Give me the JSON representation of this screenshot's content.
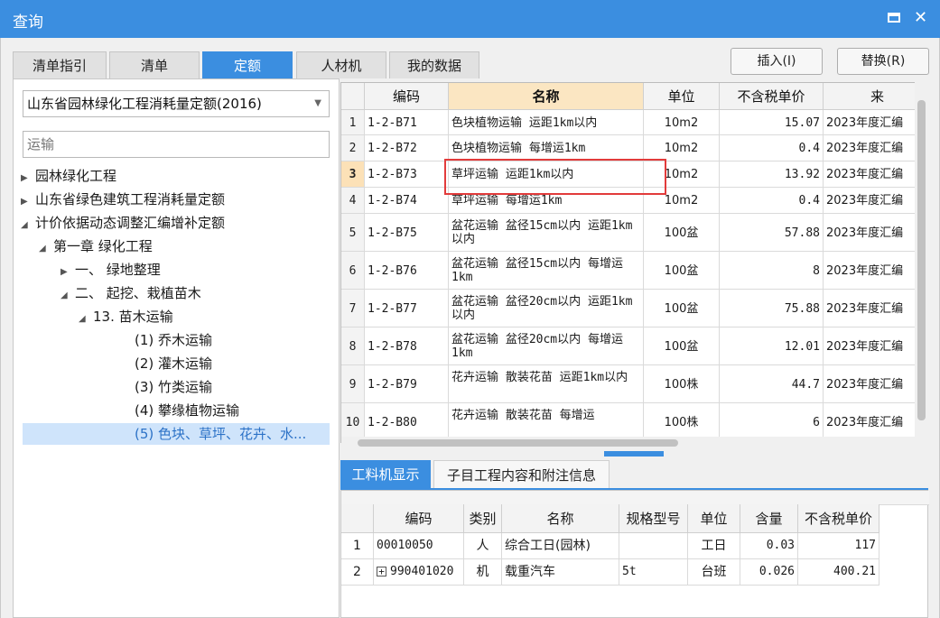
{
  "window": {
    "title": "查询",
    "max_icon": "maximize-icon",
    "close_glyph": "✕"
  },
  "tabs": [
    {
      "label": "清单指引",
      "active": false
    },
    {
      "label": "清单",
      "active": false
    },
    {
      "label": "定额",
      "active": true
    },
    {
      "label": "人材机",
      "active": false
    },
    {
      "label": "我的数据",
      "active": false
    }
  ],
  "actions": {
    "insert_label": "插入(I)",
    "replace_label": "替换(R)"
  },
  "left": {
    "library": "山东省园林绿化工程消耗量定额(2016)",
    "search_placeholder": "运输",
    "tree": [
      {
        "label": "园林绿化工程",
        "arrow": "▶",
        "selected": false
      },
      {
        "label": "山东省绿色建筑工程消耗量定额",
        "arrow": "▶",
        "selected": false
      },
      {
        "label": "计价依据动态调整汇编增补定额",
        "arrow": "◢",
        "selected": false
      },
      {
        "label": "第一章 绿化工程",
        "arrow": "◢",
        "selected": false
      },
      {
        "label": "一、 绿地整理",
        "arrow": "▶",
        "selected": false
      },
      {
        "label": "二、 起挖、栽植苗木",
        "arrow": "◢",
        "selected": false
      },
      {
        "label": "13. 苗木运输",
        "arrow": "◢",
        "selected": false
      },
      {
        "label": "(1) 乔木运输",
        "arrow": "",
        "selected": false
      },
      {
        "label": "(2) 灌木运输",
        "arrow": "",
        "selected": false
      },
      {
        "label": "(3) 竹类运输",
        "arrow": "",
        "selected": false
      },
      {
        "label": "(4) 攀缘植物运输",
        "arrow": "",
        "selected": false
      },
      {
        "label": "(5) 色块、草坪、花卉、水...",
        "arrow": "",
        "selected": true
      }
    ]
  },
  "grid": {
    "headers": [
      "",
      "编码",
      "名称",
      "单位",
      "不含税单价",
      "来"
    ],
    "rows": [
      {
        "n": "1",
        "code": "1-2-B71",
        "name": "色块植物运输 运距1km以内",
        "unit": "10m2",
        "price": "15.07",
        "src": "2023年度汇编"
      },
      {
        "n": "2",
        "code": "1-2-B72",
        "name": "色块植物运输 每增运1km",
        "unit": "10m2",
        "price": "0.4",
        "src": "2023年度汇编"
      },
      {
        "n": "3",
        "code": "1-2-B73",
        "name": "草坪运输 运距1km以内",
        "unit": "10m2",
        "price": "13.92",
        "src": "2023年度汇编"
      },
      {
        "n": "4",
        "code": "1-2-B74",
        "name": "草坪运输 每增运1km",
        "unit": "10m2",
        "price": "0.4",
        "src": "2023年度汇编"
      },
      {
        "n": "5",
        "code": "1-2-B75",
        "name": "盆花运输 盆径15cm以内 运距1km以内",
        "unit": "100盆",
        "price": "57.88",
        "src": "2023年度汇编"
      },
      {
        "n": "6",
        "code": "1-2-B76",
        "name": "盆花运输 盆径15cm以内 每增运1km",
        "unit": "100盆",
        "price": "8",
        "src": "2023年度汇编"
      },
      {
        "n": "7",
        "code": "1-2-B77",
        "name": "盆花运输 盆径20cm以内 运距1km以内",
        "unit": "100盆",
        "price": "75.88",
        "src": "2023年度汇编"
      },
      {
        "n": "8",
        "code": "1-2-B78",
        "name": "盆花运输 盆径20cm以内 每增运1km",
        "unit": "100盆",
        "price": "12.01",
        "src": "2023年度汇编"
      },
      {
        "n": "9",
        "code": "1-2-B79",
        "name": "花卉运输 散装花苗 运距1km以内",
        "unit": "100株",
        "price": "44.7",
        "src": "2023年度汇编"
      },
      {
        "n": "10",
        "code": "1-2-B80",
        "name": "花卉运输 散装花苗 每增运",
        "unit": "100株",
        "price": "6",
        "src": "2023年度汇编"
      }
    ],
    "current_row": "3"
  },
  "bottom_tabs": [
    {
      "label": "工料机显示",
      "active": true
    },
    {
      "label": "子目工程内容和附注信息",
      "active": false
    }
  ],
  "bottom_grid": {
    "headers": [
      "",
      "编码",
      "类别",
      "名称",
      "规格型号",
      "单位",
      "含量",
      "不含税单价"
    ],
    "rows": [
      {
        "n": "1",
        "code": "00010050",
        "type": "人",
        "name": "综合工日(园林)",
        "spec": "",
        "unit": "工日",
        "qty": "0.03",
        "price": "117",
        "expand": false
      },
      {
        "n": "2",
        "code": "990401020",
        "type": "机",
        "name": "载重汽车",
        "spec": "5t",
        "unit": "台班",
        "qty": "0.026",
        "price": "400.21",
        "expand": true
      }
    ]
  },
  "colors": {
    "accent": "#3b8ee0",
    "highlight": "#e23b3b",
    "selected_bg": "#cfe4fb"
  }
}
